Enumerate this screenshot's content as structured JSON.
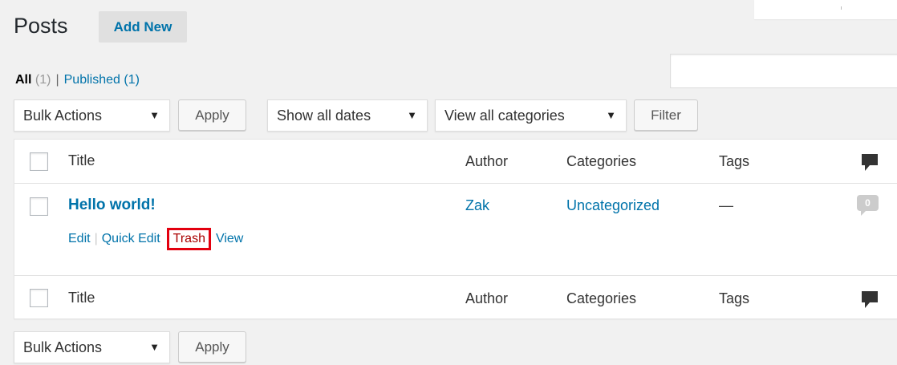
{
  "header": {
    "title": "Posts",
    "add_new_label": "Add New"
  },
  "views": {
    "all_label": "All",
    "all_count": "(1)",
    "separator": "|",
    "published_label": "Published",
    "published_count": "(1)"
  },
  "top_nav": {
    "bulk_actions": "Bulk Actions",
    "apply_label": "Apply",
    "dates_filter": "Show all dates",
    "categories_filter": "View all categories",
    "filter_label": "Filter"
  },
  "table": {
    "columns": {
      "title": "Title",
      "author": "Author",
      "categories": "Categories",
      "tags": "Tags"
    },
    "rows": [
      {
        "title": "Hello world!",
        "author": "Zak",
        "categories": "Uncategorized",
        "tags": "—",
        "comments": "0",
        "actions": {
          "edit": "Edit",
          "quick_edit": "Quick Edit",
          "trash": "Trash",
          "view": "View"
        }
      }
    ]
  },
  "bottom_nav": {
    "bulk_actions": "Bulk Actions",
    "apply_label": "Apply"
  },
  "icons": {
    "comments_header": "comment-bubble-icon",
    "dropdown": "caret-down-icon"
  },
  "colors": {
    "link": "#0073aa",
    "trash_highlight": "#e3000f",
    "background": "#f1f1f1"
  }
}
